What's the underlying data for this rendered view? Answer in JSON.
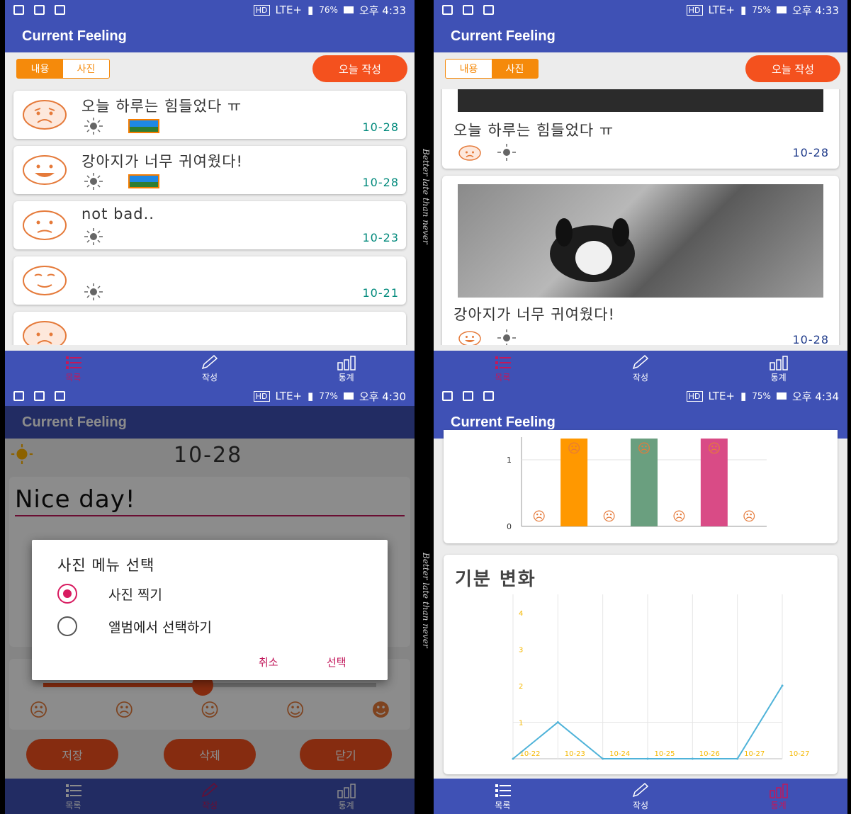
{
  "app_title": "Current Feeling",
  "watermark": "Better late than never",
  "screens": {
    "list": {
      "status": {
        "battery": "76%",
        "time": "오후 4:33",
        "network": "HD",
        "lte": "LTE+"
      },
      "tabs": [
        "내용",
        "사진"
      ],
      "today_button": "오늘 작성",
      "entries": [
        {
          "text": "오늘 하루는 힘들었다 ㅠ",
          "date": "10-28",
          "mood": "sad",
          "weather": "sun-icon",
          "has_photo": true
        },
        {
          "text": "강아지가 너무 귀여웠다!",
          "date": "10-28",
          "mood": "happy",
          "weather": "sun-icon",
          "has_photo": true
        },
        {
          "text": "not bad..",
          "date": "10-23",
          "mood": "meh",
          "weather": "sun-icon",
          "has_photo": false
        },
        {
          "text": "",
          "date": "10-21",
          "mood": "smile",
          "weather": "sun-icon",
          "has_photo": false
        },
        {
          "text": "",
          "date": "",
          "mood": "sad",
          "weather": "sun-icon",
          "has_photo": false
        }
      ]
    },
    "photos": {
      "status": {
        "battery": "75%",
        "time": "오후 4:33",
        "network": "HD",
        "lte": "LTE+"
      },
      "tabs": [
        "내용",
        "사진"
      ],
      "today_button": "오늘 작성",
      "entries": [
        {
          "text": "오늘 하루는 힘들었다 ㅠ",
          "date": "10-28"
        },
        {
          "text": "강아지가 너무 귀여웠다!",
          "date": "10-28"
        }
      ]
    },
    "write": {
      "status": {
        "battery": "77%",
        "time": "오후 4:30",
        "network": "HD",
        "lte": "LTE+"
      },
      "date": "10-28",
      "content_value": "Nice day!",
      "buttons": {
        "save": "저장",
        "delete": "삭제",
        "close": "닫기"
      },
      "dialog": {
        "title": "사진 메뉴 선택",
        "options": [
          "사진 찍기",
          "앨범에서 선택하기"
        ],
        "selected": 0,
        "cancel": "취소",
        "confirm": "선택"
      }
    },
    "stats": {
      "status": {
        "battery": "75%",
        "time": "오후 4:34",
        "network": "HD",
        "lte": "LTE+"
      },
      "mood_change_title": "기분 변화",
      "chart_data": [
        {
          "type": "bar",
          "title": "",
          "yticks": [
            "1",
            "0"
          ],
          "ylim": [
            0,
            1
          ],
          "series": [
            {
              "values": [
                0,
                1,
                0,
                1,
                0,
                1,
                0
              ]
            }
          ],
          "colors": [
            "#ff9800",
            "#ff9800",
            "#ff9800",
            "#6a9f7f",
            "#6a9f7f",
            "#d94b86",
            "#d94b86"
          ]
        },
        {
          "type": "line",
          "title": "기분 변화",
          "categories": [
            "10-22",
            "10-23",
            "10-24",
            "10-25",
            "10-26",
            "10-27",
            "10-27"
          ],
          "values": [
            0,
            1,
            0,
            0,
            0,
            0,
            2
          ],
          "yticks": [
            "1",
            "2",
            "3",
            "4"
          ],
          "ylim": [
            0,
            4.5
          ],
          "grid": true,
          "line_color": "#4fb3d9"
        }
      ]
    }
  },
  "nav": {
    "list": "목록",
    "write": "작성",
    "stats": "통계"
  }
}
